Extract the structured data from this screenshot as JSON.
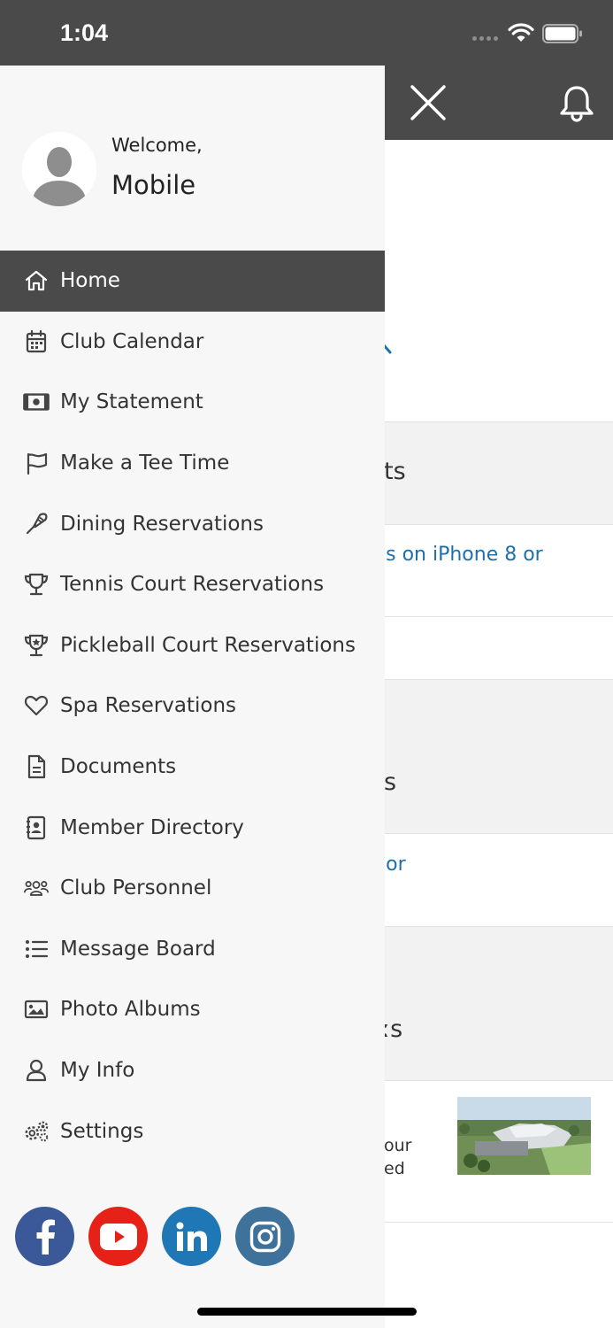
{
  "status_bar": {
    "time": "1:04"
  },
  "drawer": {
    "welcome": "Welcome,",
    "user_name": "Mobile",
    "menu": [
      {
        "label": "Home",
        "icon": "home-icon",
        "active": true
      },
      {
        "label": "Club Calendar",
        "icon": "calendar-icon"
      },
      {
        "label": "My Statement",
        "icon": "money-icon"
      },
      {
        "label": "Make a Tee Time",
        "icon": "flag-icon"
      },
      {
        "label": "Dining Reservations",
        "icon": "utensil-icon"
      },
      {
        "label": "Tennis Court Reservations",
        "icon": "trophy-icon"
      },
      {
        "label": "Pickleball Court Reservations",
        "icon": "award-trophy-icon"
      },
      {
        "label": "Spa Reservations",
        "icon": "heart-icon"
      },
      {
        "label": "Documents",
        "icon": "document-icon"
      },
      {
        "label": "Member Directory",
        "icon": "contact-book-icon"
      },
      {
        "label": "Club Personnel",
        "icon": "users-icon"
      },
      {
        "label": "Message Board",
        "icon": "list-icon"
      },
      {
        "label": "Photo Albums",
        "icon": "image-icon"
      },
      {
        "label": "My Info",
        "icon": "user-icon"
      },
      {
        "label": "Settings",
        "icon": "gears-icon"
      }
    ],
    "social": [
      {
        "name": "facebook",
        "icon": "facebook-icon",
        "color": "#3b5998"
      },
      {
        "name": "youtube",
        "icon": "youtube-icon",
        "color": "#e62117"
      },
      {
        "name": "linkedin",
        "icon": "linkedin-icon",
        "color": "#1f77b5"
      },
      {
        "name": "instagram",
        "icon": "instagram-icon",
        "color": "#3f729b"
      }
    ]
  },
  "background": {
    "section1_title_tail": "ts",
    "section1_link_tail": "ıs on iPhone 8 or",
    "section2_title_tail": "s",
    "section2_link_tail": "ıor",
    "section3_title_tail": "ːs",
    "section3_text_line1_tail": "our",
    "section3_text_line2_tail": "ed"
  },
  "colors": {
    "header_bg": "#4a4a4a",
    "drawer_bg": "#f7f7f7",
    "active_item_bg": "#4a4a4a",
    "link": "#1f6fa8"
  }
}
